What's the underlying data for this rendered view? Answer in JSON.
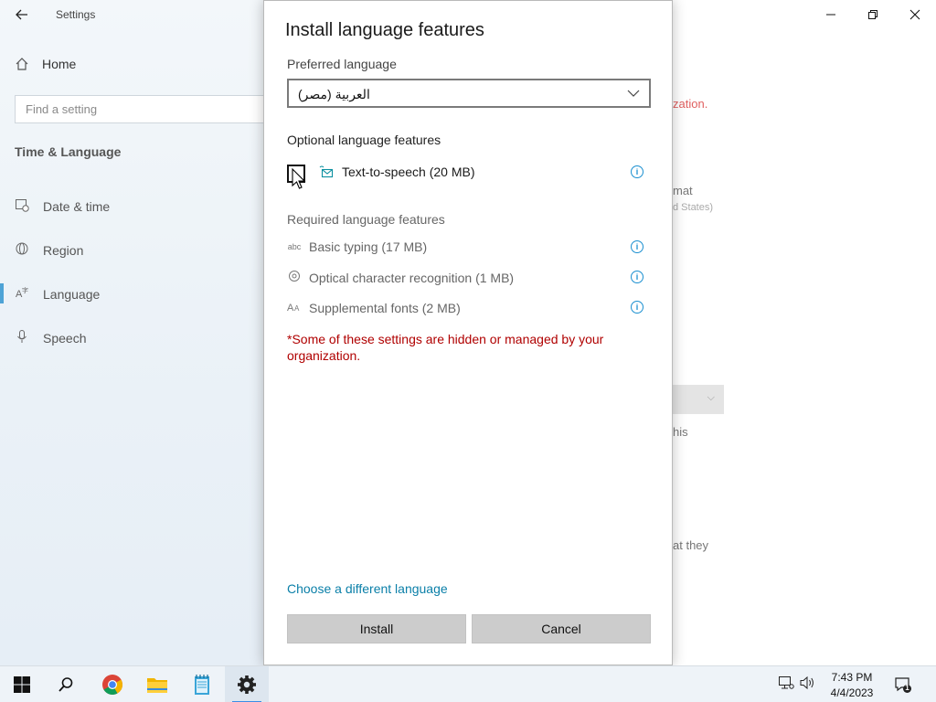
{
  "settings": {
    "app_title": "Settings",
    "home_label": "Home",
    "search_placeholder": "Find a setting",
    "section_title": "Time & Language",
    "nav_items": [
      {
        "label": "Date & time",
        "icon": "calendar-clock-icon"
      },
      {
        "label": "Region",
        "icon": "globe-icon"
      },
      {
        "label": "Language",
        "icon": "language-icon"
      },
      {
        "label": "Speech",
        "icon": "microphone-icon"
      }
    ],
    "background_fragments": {
      "org_text": "zation.",
      "format_text": "mat",
      "region_text": "d States)",
      "this_text": "his",
      "they_text": "at they"
    }
  },
  "dialog": {
    "title": "Install language features",
    "preferred_label": "Preferred language",
    "preferred_value": "العربية (مصر)",
    "optional_label": "Optional language features",
    "optional_features": [
      {
        "label": "Text-to-speech (20 MB)",
        "checked": false,
        "icon": "speech-icon"
      }
    ],
    "required_label": "Required language features",
    "required_features": [
      {
        "label": "Basic typing (17 MB)",
        "icon": "abc-icon"
      },
      {
        "label": "Optical character recognition (1 MB)",
        "icon": "ocr-icon"
      },
      {
        "label": "Supplemental fonts (2 MB)",
        "icon": "font-icon"
      }
    ],
    "warning": "*Some of these settings are hidden or managed by your organization.",
    "choose_link": "Choose a different language",
    "install_label": "Install",
    "cancel_label": "Cancel"
  },
  "taskbar": {
    "time": "7:43 PM",
    "date": "4/4/2023",
    "notification_count": "1"
  },
  "colors": {
    "accent": "#0a7fa8",
    "warning": "#b00000",
    "info": "#1a8fd0"
  }
}
